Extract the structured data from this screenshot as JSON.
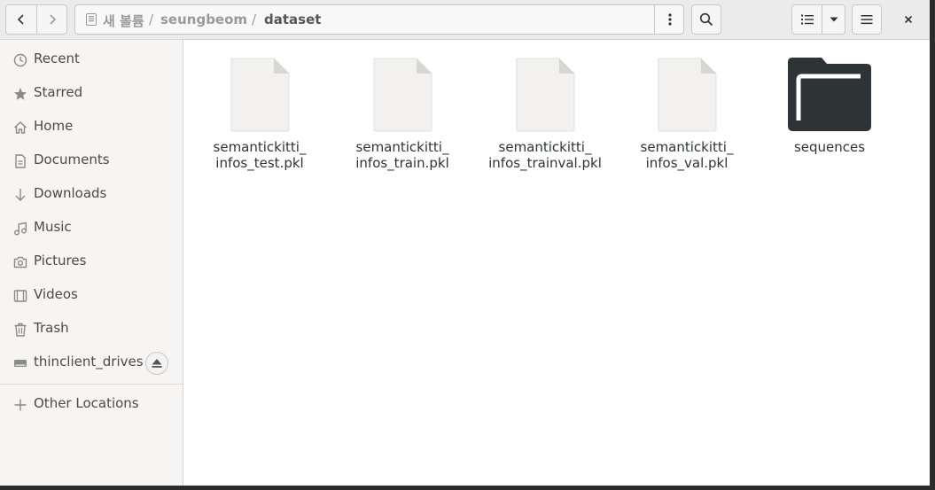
{
  "header": {
    "path": [
      {
        "label": "새 볼륨"
      },
      {
        "label": "seungbeom"
      },
      {
        "label": "dataset"
      }
    ],
    "path_separator": "/"
  },
  "sidebar": {
    "items": [
      {
        "label": "Recent",
        "icon": "clock-icon"
      },
      {
        "label": "Starred",
        "icon": "star-icon"
      },
      {
        "label": "Home",
        "icon": "home-icon"
      },
      {
        "label": "Documents",
        "icon": "document-icon"
      },
      {
        "label": "Downloads",
        "icon": "download-icon"
      },
      {
        "label": "Music",
        "icon": "music-icon"
      },
      {
        "label": "Pictures",
        "icon": "camera-icon"
      },
      {
        "label": "Videos",
        "icon": "video-icon"
      },
      {
        "label": "Trash",
        "icon": "trash-icon"
      },
      {
        "label": "thinclient_drives",
        "icon": "drive-icon"
      }
    ],
    "other_locations": "Other Locations"
  },
  "files": [
    {
      "line1": "semantickitti_",
      "line2": "infos_test.pkl",
      "type": "file"
    },
    {
      "line1": "semantickitti_",
      "line2": "infos_train.pkl",
      "type": "file"
    },
    {
      "line1": "semantickitti_",
      "line2": "infos_trainval.pkl",
      "type": "file"
    },
    {
      "line1": "semantickitti_",
      "line2": "infos_val.pkl",
      "type": "file"
    },
    {
      "line1": "sequences",
      "line2": "",
      "type": "folder"
    }
  ],
  "colors": {
    "folder": "#2e3436",
    "file_thumb": "#f2f1f0"
  }
}
